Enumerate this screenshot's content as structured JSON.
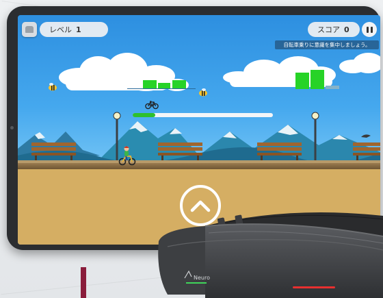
{
  "hud": {
    "level_label": "レベル",
    "level_value": "1",
    "score_label": "スコア",
    "score_value": "0",
    "instruction": "自転車乗りに意識を集中しましょう。"
  },
  "game": {
    "progress": 0.16,
    "progress_icon": "bicycle-icon",
    "control_icon": "chevron-up-icon"
  },
  "device": {
    "brand": "Neuro"
  },
  "colors": {
    "progress_fill": "#2ec02e",
    "sky": "#2d8fe0",
    "ground": "#d5ae63",
    "headband": "#4a4c50",
    "led": "#e83030"
  }
}
